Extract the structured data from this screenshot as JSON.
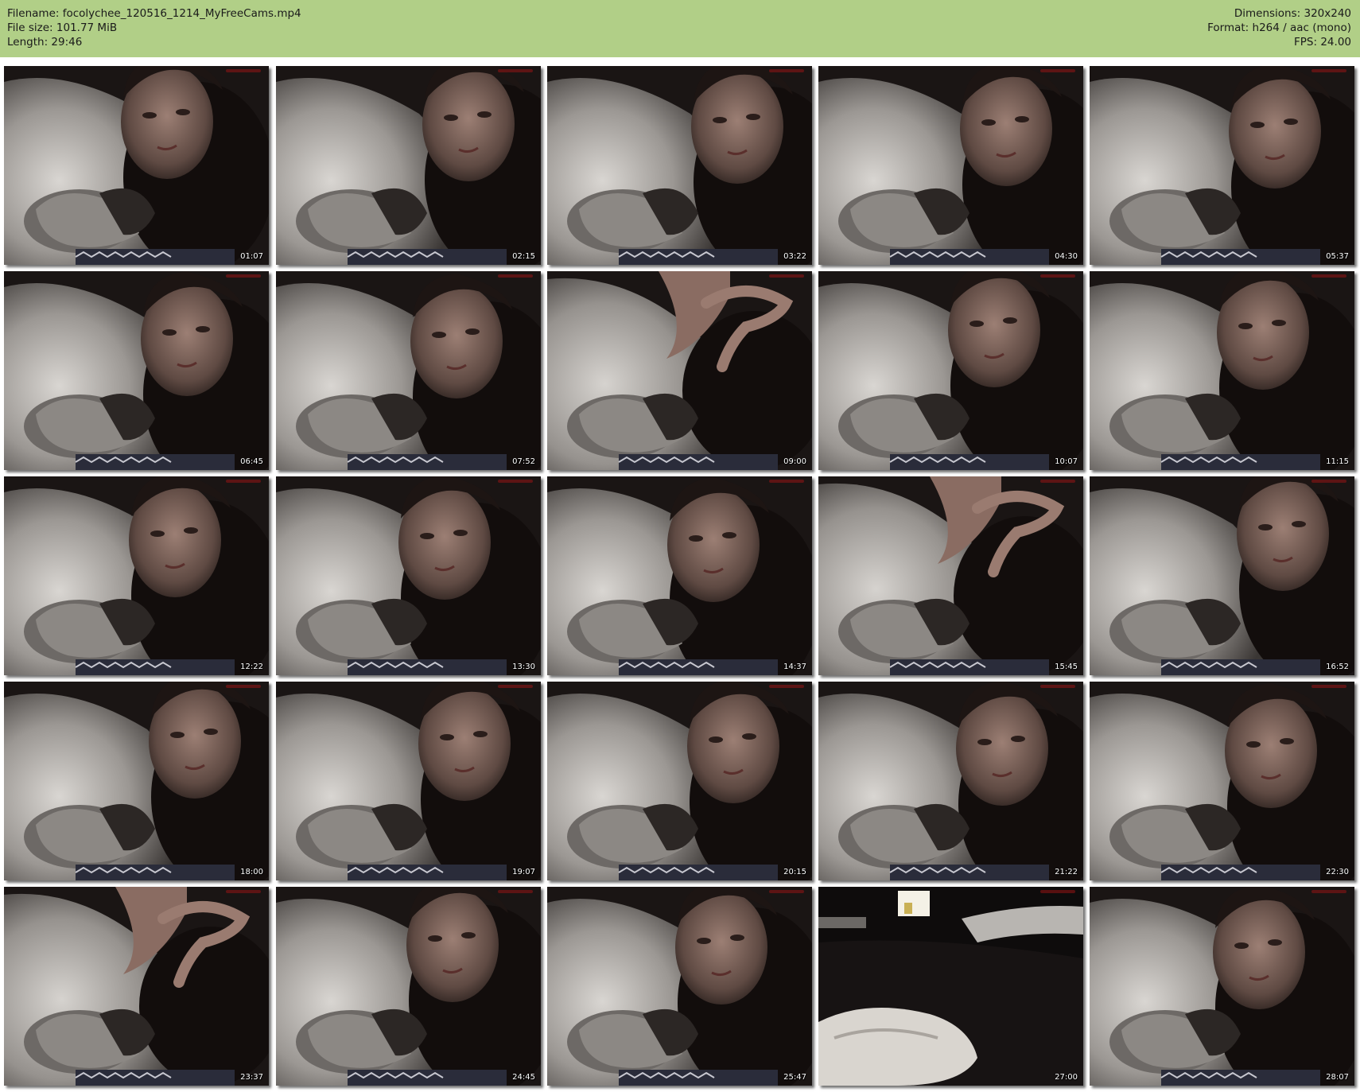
{
  "header": {
    "filename": "Filename: focolychee_120516_1214_MyFreeCams.mp4",
    "filesize": "File size: 101.77 MiB",
    "length": "Length: 29:46",
    "dimensions": "Dimensions: 320x240",
    "format": "Format: h264 / aac (mono)",
    "fps": "FPS: 24.00",
    "bg_color": "#b1cf87"
  },
  "thumbnails": [
    {
      "time": "01:07",
      "variant": "face"
    },
    {
      "time": "02:15",
      "variant": "face"
    },
    {
      "time": "03:22",
      "variant": "face"
    },
    {
      "time": "04:30",
      "variant": "face"
    },
    {
      "time": "05:37",
      "variant": "face"
    },
    {
      "time": "06:45",
      "variant": "face"
    },
    {
      "time": "07:52",
      "variant": "face"
    },
    {
      "time": "09:00",
      "variant": "chin"
    },
    {
      "time": "10:07",
      "variant": "face"
    },
    {
      "time": "11:15",
      "variant": "face"
    },
    {
      "time": "12:22",
      "variant": "face"
    },
    {
      "time": "13:30",
      "variant": "face"
    },
    {
      "time": "14:37",
      "variant": "face"
    },
    {
      "time": "15:45",
      "variant": "chin"
    },
    {
      "time": "16:52",
      "variant": "face"
    },
    {
      "time": "18:00",
      "variant": "face"
    },
    {
      "time": "19:07",
      "variant": "face"
    },
    {
      "time": "20:15",
      "variant": "face"
    },
    {
      "time": "21:22",
      "variant": "face"
    },
    {
      "time": "22:30",
      "variant": "face"
    },
    {
      "time": "23:37",
      "variant": "chin"
    },
    {
      "time": "24:45",
      "variant": "face"
    },
    {
      "time": "25:47",
      "variant": "face"
    },
    {
      "time": "27:00",
      "variant": "room"
    },
    {
      "time": "28:07",
      "variant": "face"
    }
  ]
}
